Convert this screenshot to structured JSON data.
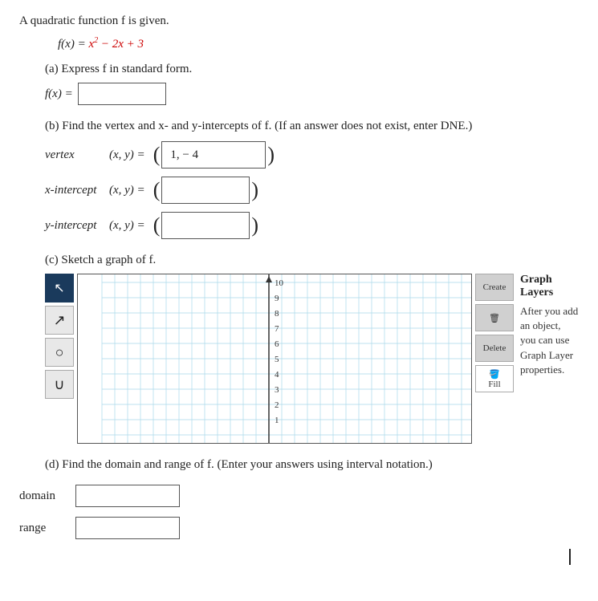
{
  "intro": {
    "text": "A quadratic function f is given."
  },
  "function_display": {
    "label": "f(x) = x² − 2x + 3"
  },
  "part_a": {
    "label": "(a) Express f in standard form.",
    "input_prefix": "f(x) =",
    "input_value": ""
  },
  "part_b": {
    "label": "(b) Find the vertex and x- and y-intercepts of f. (If an answer does not exist, enter DNE.)",
    "vertex_label": "vertex",
    "xy_equals": "(x, y) =",
    "vertex_value": "1, − 4",
    "x_intercept_label": "x-intercept",
    "y_intercept_label": "y-intercept",
    "x_input_value": "",
    "y_input_value": ""
  },
  "part_c": {
    "label": "(c) Sketch a graph of f.",
    "tools": [
      {
        "name": "cursor",
        "symbol": "↖",
        "active": true
      },
      {
        "name": "arrow",
        "symbol": "↗",
        "active": false
      },
      {
        "name": "circle",
        "symbol": "○",
        "active": false
      },
      {
        "name": "parabola",
        "symbol": "∪",
        "active": false
      }
    ],
    "side_tools": [
      {
        "name": "Create",
        "label": "Create"
      },
      {
        "name": "Delete",
        "label": "Delete"
      },
      {
        "name": "Fill",
        "label": "Fill"
      }
    ],
    "graph_layers": {
      "title": "Graph Layers",
      "description": "After you add an object, you can use Graph Layer properties."
    },
    "y_axis_labels": [
      "10",
      "9",
      "8",
      "7",
      "6",
      "5",
      "4",
      "3",
      "2",
      "1"
    ]
  },
  "part_d": {
    "label": "(d) Find the domain and range of f. (Enter your answers using interval notation.)",
    "domain_label": "domain",
    "range_label": "range",
    "domain_value": "",
    "range_value": ""
  }
}
